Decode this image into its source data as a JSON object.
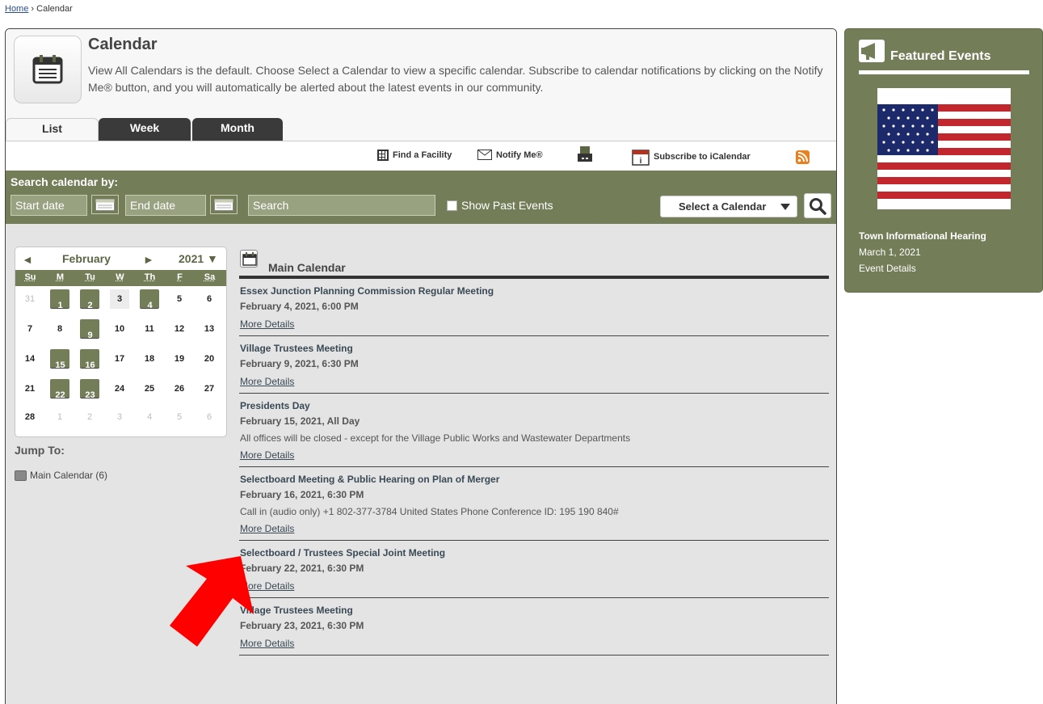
{
  "breadcrumb": {
    "home": "Home",
    "separator": "›",
    "current": "Calendar"
  },
  "header": {
    "title": "Calendar",
    "intro": "View All Calendars is the default. Choose Select a Calendar to view a specific calendar. Subscribe to calendar notifications by clicking on the Notify Me® button, and you will automatically be alerted about the latest events in our community."
  },
  "tabs": [
    {
      "label": "List"
    },
    {
      "label": "Week"
    },
    {
      "label": "Month"
    }
  ],
  "tools": {
    "find_facility": "Find a Facility",
    "notify": "Notify Me®",
    "subscribe": "Subscribe to iCalendar"
  },
  "search": {
    "label": "Search calendar by:",
    "start_placeholder": "Start date",
    "end_placeholder": "End date",
    "search_placeholder": "Search",
    "past_label": "Show Past Events",
    "select_calendar": "Select a Calendar"
  },
  "mini_calendar": {
    "prev": "◄",
    "month": "February",
    "next": "►",
    "year": "2021 ▼",
    "weekdays": [
      "Su",
      "M",
      "Tu",
      "W",
      "Th",
      "F",
      "Sa"
    ],
    "weeks": [
      [
        "31",
        "1",
        "2",
        "3",
        "4",
        "5",
        "6"
      ],
      [
        "7",
        "8",
        "9",
        "10",
        "11",
        "12",
        "13"
      ],
      [
        "14",
        "15",
        "16",
        "17",
        "18",
        "19",
        "20"
      ],
      [
        "21",
        "22",
        "23",
        "24",
        "25",
        "26",
        "27"
      ],
      [
        "28",
        "1",
        "2",
        "3",
        "4",
        "5",
        "6"
      ]
    ]
  },
  "jump": {
    "title": "Jump To:",
    "item": "Main Calendar (6)"
  },
  "main_calendar": {
    "heading": "Main Calendar",
    "events": [
      {
        "title": "Essex Junction Planning Commission Regular Meeting",
        "date": "February 4, 2021, 6:00 PM",
        "desc": "",
        "link": "More Details"
      },
      {
        "title": "Village Trustees Meeting",
        "date": "February 9, 2021, 6:30 PM",
        "desc": "",
        "link": "More Details"
      },
      {
        "title": "Presidents Day",
        "date": "February 15, 2021, All Day",
        "desc": "All offices will be closed - except for the Village Public Works and Wastewater Departments",
        "link": "More Details"
      },
      {
        "title": "Selectboard Meeting & Public Hearing on Plan of Merger",
        "date": "February 16, 2021, 6:30 PM",
        "desc": "Call in (audio only) +1 802-377-3784 United States Phone Conference ID: 195 190 840#",
        "link": "More Details"
      },
      {
        "title": "Selectboard / Trustees Special Joint Meeting",
        "date": "February 22, 2021, 6:30 PM",
        "desc": "",
        "link": "More Details"
      },
      {
        "title": "Village Trustees Meeting",
        "date": "February 23, 2021, 6:30 PM",
        "desc": "",
        "link": "More Details"
      }
    ]
  },
  "featured": {
    "title": "Featured Events",
    "event_title": "Town Informational Hearing",
    "event_date": "March 1, 2021",
    "event_link": "Event Details"
  },
  "colors": {
    "accent": "#737e58",
    "dark_tab": "#3a3a3a",
    "annotation_arrow": "#ff0000"
  }
}
